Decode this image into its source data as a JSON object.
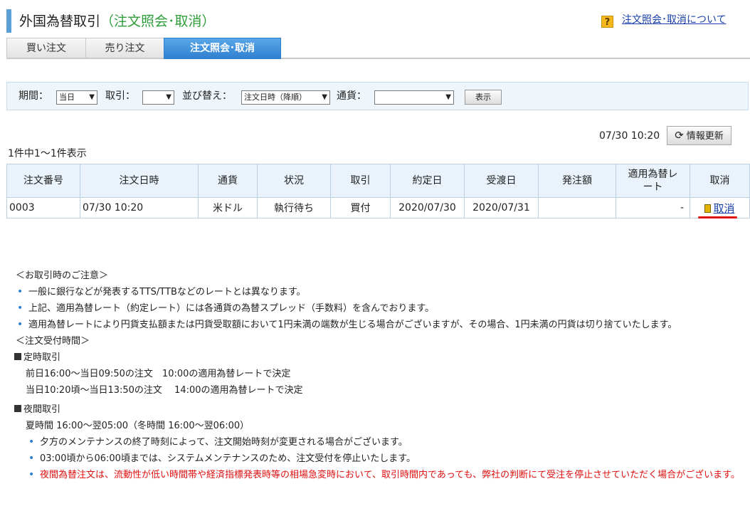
{
  "header": {
    "title": "外国為替取引",
    "subtitle": "（注文照会･取消）",
    "help_icon_text": "?",
    "help_link": "注文照会･取消について"
  },
  "tabs": [
    {
      "label": "買い注文",
      "active": false
    },
    {
      "label": "売り注文",
      "active": false
    },
    {
      "label": "注文照会･取消",
      "active": true
    }
  ],
  "filter": {
    "period_label": "期間：",
    "period_value": "当日",
    "trade_label": "取引：",
    "trade_value": "",
    "sort_label": "並び替え：",
    "sort_value": "注文日時（降順）",
    "currency_label": "通貨：",
    "currency_value": "",
    "show_button": "表示"
  },
  "refresh": {
    "timestamp": "07/30 10:20",
    "button": "情報更新"
  },
  "count_text": "1件中1～1件表示",
  "table": {
    "headers": [
      "注文番号",
      "注文日時",
      "通貨",
      "状況",
      "取引",
      "約定日",
      "受渡日",
      "発注額",
      "適用為替レート",
      "取消"
    ],
    "rows": [
      {
        "order_no": "0003",
        "order_datetime": "07/30 10:20",
        "currency": "米ドル",
        "status": "執行待ち",
        "trade": "買付",
        "execution_date": "2020/07/30",
        "delivery_date": "2020/07/31",
        "order_amount": "",
        "rate": "-",
        "cancel": "取消"
      }
    ]
  },
  "notes": {
    "caution_heading": "＜お取引時のご注意＞",
    "caution_items": [
      "一般に銀行などが発表するTTS/TTBなどのレートとは異なります。",
      "上記、適用為替レート（約定レート）には各通貨の為替スプレッド（手数料）を含んでおります。",
      "適用為替レートにより円貨支払額または円貨受取額において1円未満の端数が生じる場合がございますが、その場合、1円未満の円貨は切り捨ていたします。"
    ],
    "hours_heading": "＜注文受付時間＞",
    "regular_title": "定時取引",
    "regular_lines": [
      "前日16:00～当日09:50の注文　10:00の適用為替レートで決定",
      "当日10:20頃～当日13:50の注文　 14:00の適用為替レートで決定"
    ],
    "night_title": "夜間取引",
    "night_line": "夏時間 16:00～翌05:00（冬時間 16:00～翌06:00）",
    "night_items": [
      "夕方のメンテナンスの終了時刻によって、注文開始時刻が変更される場合がございます。",
      "03:00頃から06:00頃までは、システムメンテナンスのため、注文受付を停止いたします。"
    ],
    "night_warning": "夜間為替注文は、流動性が低い時間帯や経済指標発表時等の相場急変時において、取引時間内であっても、弊社の判断にて受注を停止させていただく場合がございます。"
  },
  "colors": {
    "accent_blue": "#2e7fd0",
    "title_green": "#2e9e3a",
    "warning_red": "#e01010",
    "link_blue": "#1a3fa8"
  }
}
